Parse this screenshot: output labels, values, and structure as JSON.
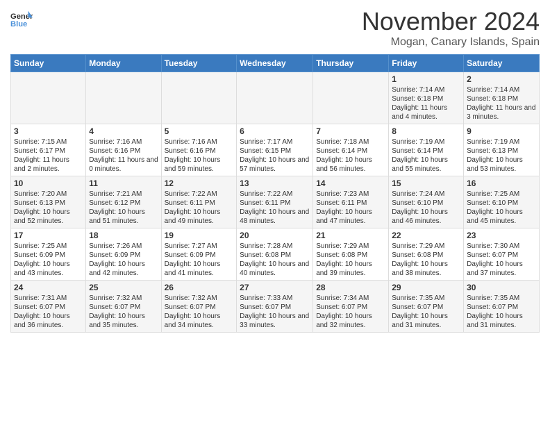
{
  "header": {
    "logo_line1": "General",
    "logo_line2": "Blue",
    "month": "November 2024",
    "location": "Mogan, Canary Islands, Spain"
  },
  "days_of_week": [
    "Sunday",
    "Monday",
    "Tuesday",
    "Wednesday",
    "Thursday",
    "Friday",
    "Saturday"
  ],
  "weeks": [
    [
      {
        "day": "",
        "info": ""
      },
      {
        "day": "",
        "info": ""
      },
      {
        "day": "",
        "info": ""
      },
      {
        "day": "",
        "info": ""
      },
      {
        "day": "",
        "info": ""
      },
      {
        "day": "1",
        "info": "Sunrise: 7:14 AM\nSunset: 6:18 PM\nDaylight: 11 hours and 4 minutes."
      },
      {
        "day": "2",
        "info": "Sunrise: 7:14 AM\nSunset: 6:18 PM\nDaylight: 11 hours and 3 minutes."
      }
    ],
    [
      {
        "day": "3",
        "info": "Sunrise: 7:15 AM\nSunset: 6:17 PM\nDaylight: 11 hours and 2 minutes."
      },
      {
        "day": "4",
        "info": "Sunrise: 7:16 AM\nSunset: 6:16 PM\nDaylight: 11 hours and 0 minutes."
      },
      {
        "day": "5",
        "info": "Sunrise: 7:16 AM\nSunset: 6:16 PM\nDaylight: 10 hours and 59 minutes."
      },
      {
        "day": "6",
        "info": "Sunrise: 7:17 AM\nSunset: 6:15 PM\nDaylight: 10 hours and 57 minutes."
      },
      {
        "day": "7",
        "info": "Sunrise: 7:18 AM\nSunset: 6:14 PM\nDaylight: 10 hours and 56 minutes."
      },
      {
        "day": "8",
        "info": "Sunrise: 7:19 AM\nSunset: 6:14 PM\nDaylight: 10 hours and 55 minutes."
      },
      {
        "day": "9",
        "info": "Sunrise: 7:19 AM\nSunset: 6:13 PM\nDaylight: 10 hours and 53 minutes."
      }
    ],
    [
      {
        "day": "10",
        "info": "Sunrise: 7:20 AM\nSunset: 6:13 PM\nDaylight: 10 hours and 52 minutes."
      },
      {
        "day": "11",
        "info": "Sunrise: 7:21 AM\nSunset: 6:12 PM\nDaylight: 10 hours and 51 minutes."
      },
      {
        "day": "12",
        "info": "Sunrise: 7:22 AM\nSunset: 6:11 PM\nDaylight: 10 hours and 49 minutes."
      },
      {
        "day": "13",
        "info": "Sunrise: 7:22 AM\nSunset: 6:11 PM\nDaylight: 10 hours and 48 minutes."
      },
      {
        "day": "14",
        "info": "Sunrise: 7:23 AM\nSunset: 6:11 PM\nDaylight: 10 hours and 47 minutes."
      },
      {
        "day": "15",
        "info": "Sunrise: 7:24 AM\nSunset: 6:10 PM\nDaylight: 10 hours and 46 minutes."
      },
      {
        "day": "16",
        "info": "Sunrise: 7:25 AM\nSunset: 6:10 PM\nDaylight: 10 hours and 45 minutes."
      }
    ],
    [
      {
        "day": "17",
        "info": "Sunrise: 7:25 AM\nSunset: 6:09 PM\nDaylight: 10 hours and 43 minutes."
      },
      {
        "day": "18",
        "info": "Sunrise: 7:26 AM\nSunset: 6:09 PM\nDaylight: 10 hours and 42 minutes."
      },
      {
        "day": "19",
        "info": "Sunrise: 7:27 AM\nSunset: 6:09 PM\nDaylight: 10 hours and 41 minutes."
      },
      {
        "day": "20",
        "info": "Sunrise: 7:28 AM\nSunset: 6:08 PM\nDaylight: 10 hours and 40 minutes."
      },
      {
        "day": "21",
        "info": "Sunrise: 7:29 AM\nSunset: 6:08 PM\nDaylight: 10 hours and 39 minutes."
      },
      {
        "day": "22",
        "info": "Sunrise: 7:29 AM\nSunset: 6:08 PM\nDaylight: 10 hours and 38 minutes."
      },
      {
        "day": "23",
        "info": "Sunrise: 7:30 AM\nSunset: 6:07 PM\nDaylight: 10 hours and 37 minutes."
      }
    ],
    [
      {
        "day": "24",
        "info": "Sunrise: 7:31 AM\nSunset: 6:07 PM\nDaylight: 10 hours and 36 minutes."
      },
      {
        "day": "25",
        "info": "Sunrise: 7:32 AM\nSunset: 6:07 PM\nDaylight: 10 hours and 35 minutes."
      },
      {
        "day": "26",
        "info": "Sunrise: 7:32 AM\nSunset: 6:07 PM\nDaylight: 10 hours and 34 minutes."
      },
      {
        "day": "27",
        "info": "Sunrise: 7:33 AM\nSunset: 6:07 PM\nDaylight: 10 hours and 33 minutes."
      },
      {
        "day": "28",
        "info": "Sunrise: 7:34 AM\nSunset: 6:07 PM\nDaylight: 10 hours and 32 minutes."
      },
      {
        "day": "29",
        "info": "Sunrise: 7:35 AM\nSunset: 6:07 PM\nDaylight: 10 hours and 31 minutes."
      },
      {
        "day": "30",
        "info": "Sunrise: 7:35 AM\nSunset: 6:07 PM\nDaylight: 10 hours and 31 minutes."
      }
    ]
  ]
}
